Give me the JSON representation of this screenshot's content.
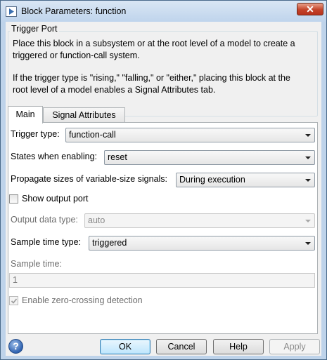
{
  "window": {
    "title": "Block Parameters: function",
    "close_symbol": "✕"
  },
  "group": {
    "title": "Trigger Port",
    "description_lines": [
      "Place this block in a subsystem or at the root level of a model to create a",
      "triggered or function-call system.",
      "If the trigger type is \"rising,\" \"falling,\" or \"either,\" placing this block at the",
      "root level of a model enables a Signal Attributes tab."
    ]
  },
  "tabs": [
    {
      "label": "Main",
      "selected": true
    },
    {
      "label": "Signal Attributes",
      "selected": false
    }
  ],
  "main": {
    "trigger_type": {
      "label": "Trigger type:",
      "value": "function-call"
    },
    "states_when_enabling": {
      "label": "States when enabling:",
      "value": "reset"
    },
    "propagate_sizes": {
      "label": "Propagate sizes of variable-size signals:",
      "value": "During execution"
    },
    "show_output_port": {
      "label": "Show output port",
      "checked": false
    },
    "output_data_type": {
      "label": "Output data type:",
      "value": "auto",
      "enabled": false
    },
    "sample_time_type": {
      "label": "Sample time type:",
      "value": "triggered"
    },
    "sample_time": {
      "label": "Sample time:",
      "value": "1",
      "enabled": false
    },
    "enable_zero_crossing": {
      "label": "Enable zero-crossing detection",
      "checked": true,
      "enabled": false
    }
  },
  "buttons": {
    "help_symbol": "?",
    "ok": "OK",
    "cancel": "Cancel",
    "help": "Help",
    "apply": "Apply"
  },
  "colors": {
    "title_bar": "#bfd4ec",
    "close_button": "#c4442a",
    "default_button": "#bee6fd"
  }
}
